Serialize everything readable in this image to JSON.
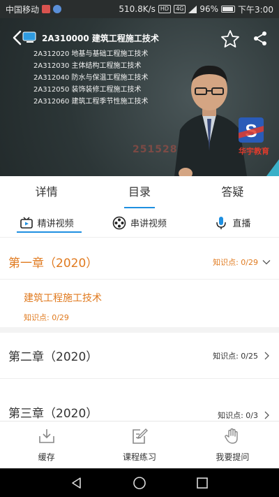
{
  "status_bar": {
    "carrier": "中国移动",
    "speed": "510.8K/s",
    "hd": "HD",
    "net": "4G",
    "battery": "96%",
    "battery_level": 0.96,
    "time": "下午3:00"
  },
  "video": {
    "course_title": "2A310000 建筑工程施工技术",
    "outline": [
      "2A312020 地基与基础工程施工技术",
      "2A312030 主体结构工程施工技术",
      "2A312040 防水与保温工程施工技术",
      "2A312050 装饰装修工程施工技术",
      "2A312060 建筑工程季节性施工技术"
    ],
    "watermark": "251528",
    "brand": "华宇教育",
    "logo_letter": "S"
  },
  "tabs": [
    {
      "label": "详情",
      "active": false
    },
    {
      "label": "目录",
      "active": true
    },
    {
      "label": "答疑",
      "active": false
    }
  ],
  "subtabs": [
    {
      "label": "精讲视频",
      "icon": "tv-icon",
      "active": true
    },
    {
      "label": "串讲视频",
      "icon": "film-reel-icon",
      "active": false
    },
    {
      "label": "直播",
      "icon": "microphone-icon",
      "active": false
    }
  ],
  "chapters": [
    {
      "title": "第一章（2020）",
      "meta": "知识点: 0/29",
      "open": true,
      "section": {
        "title": "建筑工程施工技术",
        "meta": "知识点: 0/29"
      }
    },
    {
      "title": "第二章（2020）",
      "meta": "知识点: 0/25",
      "open": false
    },
    {
      "title": "第三章（2020）",
      "meta": "知识点: 0/3",
      "open": false
    }
  ],
  "toolbar": {
    "cache_label": "缓存",
    "practice_label": "课程练习",
    "ask_label": "我要提问"
  },
  "colors": {
    "accent_blue": "#1e8fe0",
    "accent_orange": "#e07a1f",
    "brand_red": "#e03b2c"
  }
}
